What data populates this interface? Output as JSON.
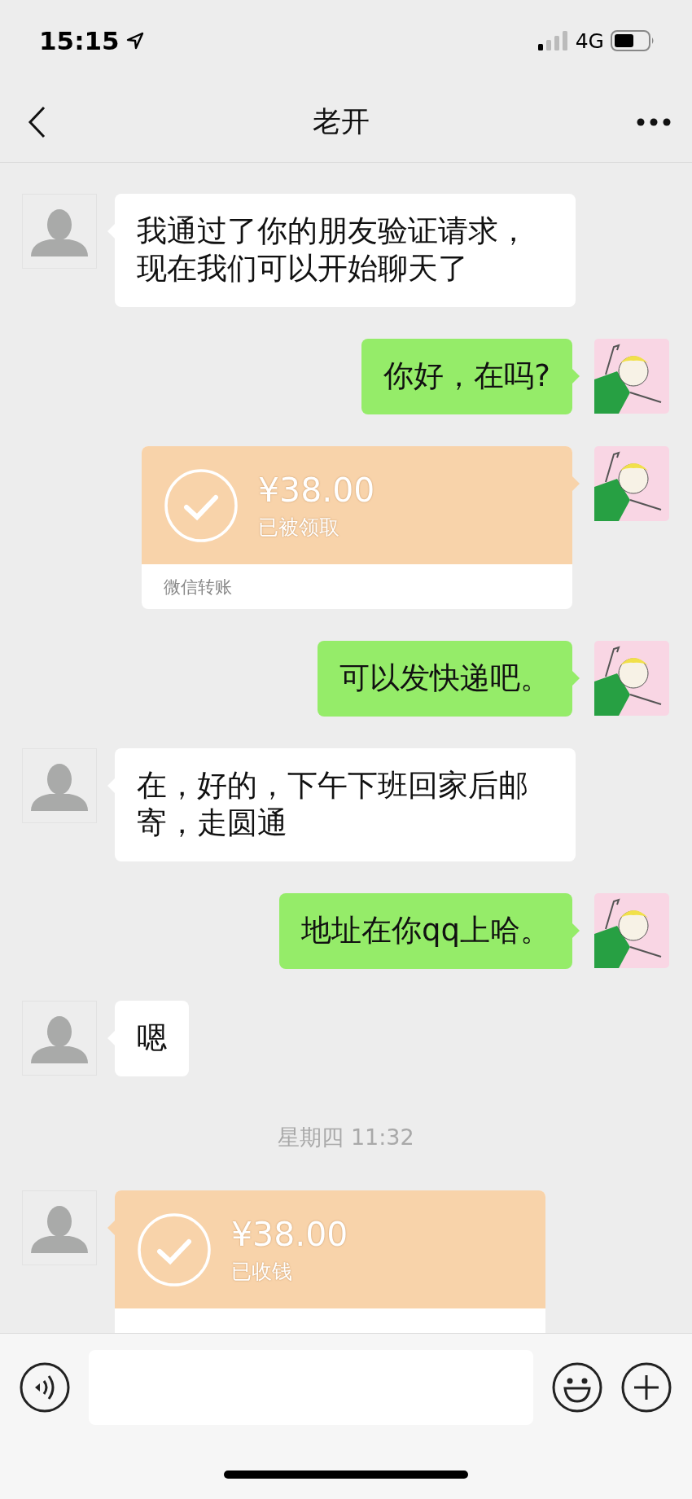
{
  "status_bar": {
    "time": "15:15",
    "network": "4G"
  },
  "nav": {
    "title": "老开"
  },
  "messages": [
    {
      "kind": "text",
      "outgoing": false,
      "text": "我通过了你的朋友验证请求，现在我们可以开始聊天了"
    },
    {
      "kind": "text",
      "outgoing": true,
      "text": "你好，在吗?"
    },
    {
      "kind": "transfer",
      "outgoing": true,
      "amount": "¥38.00",
      "status": "已被领取",
      "label": "微信转账"
    },
    {
      "kind": "text",
      "outgoing": true,
      "text": "可以发快递吧。"
    },
    {
      "kind": "text",
      "outgoing": false,
      "text": "在，好的，下午下班回家后邮寄，走圆通"
    },
    {
      "kind": "text",
      "outgoing": true,
      "text": "地址在你qq上哈。"
    },
    {
      "kind": "text",
      "outgoing": false,
      "text": "嗯"
    },
    {
      "kind": "time",
      "text": "星期四 11:32"
    },
    {
      "kind": "transfer",
      "outgoing": false,
      "amount": "¥38.00",
      "status": "已收钱"
    }
  ]
}
